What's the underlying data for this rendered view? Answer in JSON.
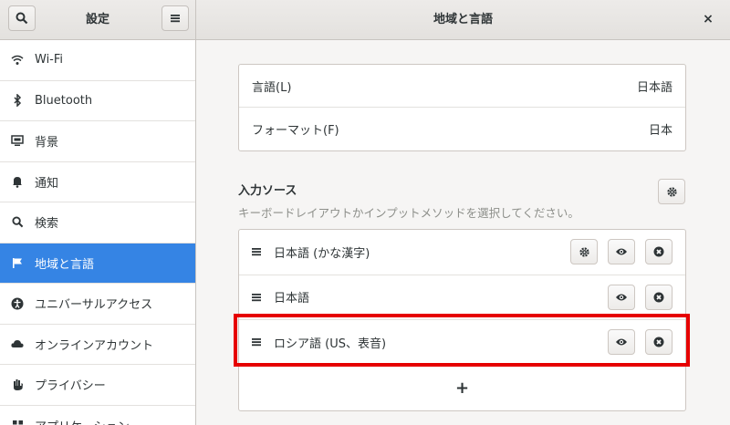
{
  "header": {
    "left_title": "設定",
    "main_title": "地域と言語",
    "search_icon": "search-icon",
    "menu_icon": "hamburger-menu-icon",
    "close_label": "×"
  },
  "sidebar": {
    "items": [
      {
        "label": "Wi-Fi",
        "icon": "wifi-icon"
      },
      {
        "label": "Bluetooth",
        "icon": "bluetooth-icon"
      },
      {
        "label": "背景",
        "icon": "background-icon"
      },
      {
        "label": "通知",
        "icon": "bell-icon"
      },
      {
        "label": "検索",
        "icon": "search-icon"
      },
      {
        "label": "地域と言語",
        "icon": "flag-icon",
        "active": true
      },
      {
        "label": "ユニバーサルアクセス",
        "icon": "accessibility-icon"
      },
      {
        "label": "オンラインアカウント",
        "icon": "cloud-icon"
      },
      {
        "label": "プライバシー",
        "icon": "hand-icon"
      },
      {
        "label": "アプリケーション",
        "icon": "apps-icon"
      }
    ]
  },
  "settings": {
    "language_label": "言語(L)",
    "language_value": "日本語",
    "formats_label": "フォーマット(F)",
    "formats_value": "日本"
  },
  "input_sources": {
    "title": "入力ソース",
    "description": "キーボードレイアウトかインプットメソッドを選択してください。",
    "items": [
      {
        "label": "日本語 (かな漢字)",
        "has_settings": true
      },
      {
        "label": "日本語",
        "has_settings": false
      },
      {
        "label": "ロシア語 (US、表音)",
        "has_settings": false
      }
    ],
    "add_label": "+"
  },
  "colors": {
    "accent": "#3584e4",
    "highlight": "#e60000"
  }
}
